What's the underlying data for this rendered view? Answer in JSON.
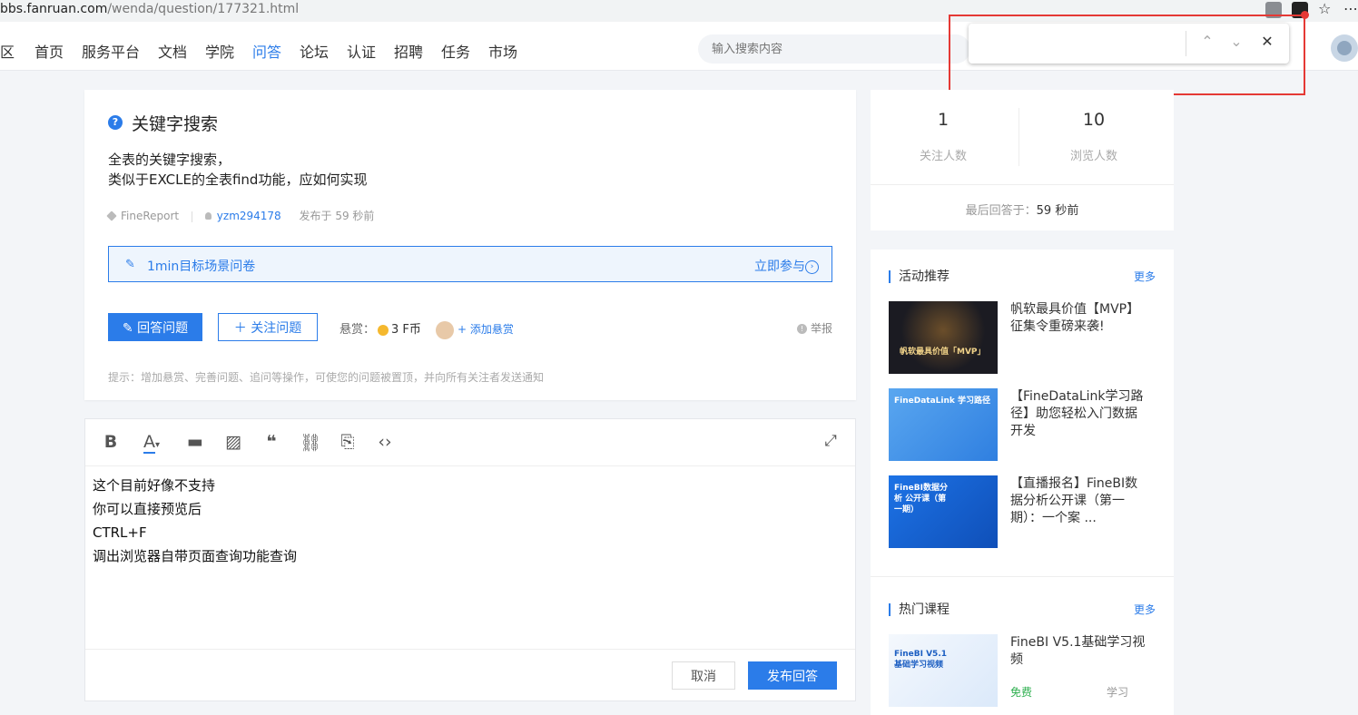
{
  "browser": {
    "url_host": "bbs.fanruan.com",
    "url_path": "/wenda/question/177321.html"
  },
  "nav": {
    "edge_text": "区",
    "items": [
      "首页",
      "服务平台",
      "文档",
      "学院",
      "问答",
      "论坛",
      "认证",
      "招聘",
      "任务",
      "市场"
    ],
    "active": "问答",
    "search_placeholder": "输入搜索内容"
  },
  "findbar": {
    "query": "",
    "prev": "⌃",
    "next": "⌄",
    "close": "✕"
  },
  "question": {
    "icon": "?",
    "title": "关键字搜索",
    "body_lines": [
      "全表的关键字搜索，",
      "类似于EXCLE的全表find功能，应如何实现"
    ],
    "tag": "FineReport",
    "author": "yzm294178",
    "posted": "发布于 59 秒前",
    "survey_label": "1min目标场景问卷",
    "survey_action": "立即参与",
    "answer_button": "回答问题",
    "follow_button": "关注问题",
    "bounty_label": "悬赏：",
    "bounty_amount": "3 F币",
    "add_bounty": "+ 添加悬赏",
    "report": "举报",
    "tip": "提示：增加悬赏、完善问题、追问等操作，可使您的问题被置顶，并向所有关注者发送通知"
  },
  "editor": {
    "content_lines": [
      "这个目前好像不支持",
      "你可以直接预览后",
      "CTRL+F",
      "调出浏览器自带页面查询功能查询"
    ],
    "cancel": "取消",
    "publish": "发布回答"
  },
  "stats": {
    "followers": "1",
    "followers_label": "关注人数",
    "views": "10",
    "views_label": "浏览人数",
    "last_answer_label": "最后回答于：",
    "last_answer_value": "59 秒前"
  },
  "activities": {
    "title": "活动推荐",
    "more": "更多",
    "items": [
      {
        "title": "帆软最具价值【MVP】征集令重磅来袭!",
        "thumb_text": "帆软最具价值「MVP」",
        "bg": "#1b1b22"
      },
      {
        "title": "【FineDataLink学习路径】助您轻松入门数据开发",
        "thumb_text": "FineDataLink 学习路径",
        "bg": "#3d8fe6"
      },
      {
        "title": "【直播报名】FineBI数据分析公开课（第一期）：一个案 ...",
        "thumb_text": "FineBI数据分析 公开课（第一期）",
        "bg": "#1466d8"
      }
    ]
  },
  "courses": {
    "title": "热门课程",
    "more": "更多",
    "items": [
      {
        "title": "FineBI V5.1基础学习视频",
        "thumb_text": "FineBI V5.1 基础学习视频",
        "price": "免费",
        "tag": "学习",
        "bg": "#e8f1fb"
      }
    ]
  }
}
